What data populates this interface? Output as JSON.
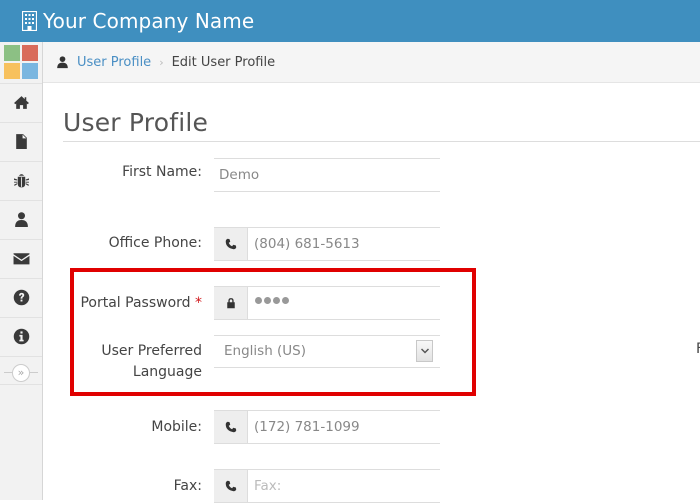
{
  "app": {
    "title": "Your Company Name",
    "brand_color": "#3f8fbf",
    "logo_colors": [
      "#8cc084",
      "#d96b5a",
      "#f7c15e",
      "#7ab6e0"
    ]
  },
  "sidebar": {
    "items": [
      {
        "icon": "home-icon",
        "label": "Home"
      },
      {
        "icon": "document-icon",
        "label": "Documents"
      },
      {
        "icon": "bug-icon",
        "label": "Bugs"
      },
      {
        "icon": "user-icon",
        "label": "User"
      },
      {
        "icon": "envelope-icon",
        "label": "Messages"
      },
      {
        "icon": "question-icon",
        "label": "Help"
      },
      {
        "icon": "info-icon",
        "label": "Info"
      }
    ],
    "collapse_glyph": "»"
  },
  "breadcrumb": {
    "icon": "user-icon",
    "link": "User Profile",
    "separator": "›",
    "current": "Edit User Profile"
  },
  "page": {
    "title": "User Profile"
  },
  "form": {
    "first_name": {
      "label": "First Name:",
      "value": "Demo"
    },
    "office_phone": {
      "label": "Office Phone:",
      "icon": "phone-icon",
      "value": "(804) 681-5613"
    },
    "portal_password": {
      "label": "Portal Password",
      "required_mark": "*",
      "icon": "lock-icon",
      "masked_length": 4
    },
    "language": {
      "label_line1": "User Preferred",
      "label_line2": "Language",
      "selected": "English (US)"
    },
    "mobile": {
      "label": "Mobile:",
      "icon": "phone-icon",
      "value": "(172) 781-1099"
    },
    "fax": {
      "label": "Fax:",
      "icon": "phone-icon",
      "value": "",
      "placeholder": "Fax:"
    },
    "cut_off_label": "F"
  },
  "highlight": {
    "color": "#e00000"
  }
}
